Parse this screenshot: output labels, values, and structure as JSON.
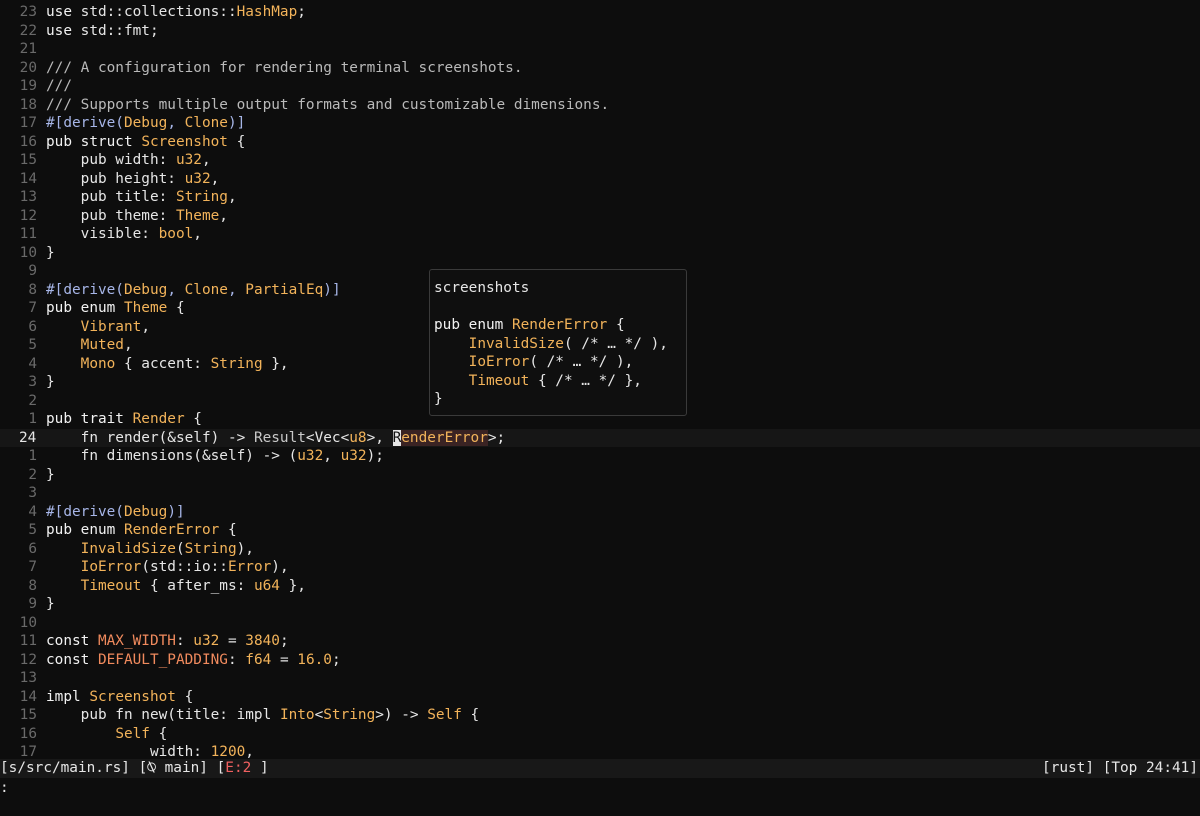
{
  "editor": {
    "current_line_label": "24",
    "lines": [
      {
        "num": "23",
        "tokens": [
          [
            "kw",
            "use "
          ],
          [
            "pl",
            "std::collections::"
          ],
          [
            "ty",
            "HashMap"
          ],
          [
            "pl",
            ";"
          ]
        ]
      },
      {
        "num": "22",
        "tokens": [
          [
            "kw",
            "use "
          ],
          [
            "pl",
            "std::fmt;"
          ]
        ]
      },
      {
        "num": "21",
        "tokens": []
      },
      {
        "num": "20",
        "tokens": [
          [
            "cm",
            "/// A configuration for rendering terminal screenshots."
          ]
        ]
      },
      {
        "num": "19",
        "tokens": [
          [
            "cm",
            "///"
          ]
        ]
      },
      {
        "num": "18",
        "tokens": [
          [
            "cm",
            "/// Supports multiple output formats and customizable dimensions."
          ]
        ]
      },
      {
        "num": "17",
        "tokens": [
          [
            "at",
            "#[derive("
          ],
          [
            "ty",
            "Debug"
          ],
          [
            "at",
            ", "
          ],
          [
            "ty",
            "Clone"
          ],
          [
            "at",
            ")]"
          ]
        ]
      },
      {
        "num": "16",
        "tokens": [
          [
            "kw",
            "pub struct "
          ],
          [
            "ty",
            "Screenshot"
          ],
          [
            "pl",
            " {"
          ]
        ]
      },
      {
        "num": "15",
        "tokens": [
          [
            "pl",
            "    pub width: "
          ],
          [
            "ty",
            "u32"
          ],
          [
            "pl",
            ","
          ]
        ]
      },
      {
        "num": "14",
        "tokens": [
          [
            "pl",
            "    pub height: "
          ],
          [
            "ty",
            "u32"
          ],
          [
            "pl",
            ","
          ]
        ]
      },
      {
        "num": "13",
        "tokens": [
          [
            "pl",
            "    pub title: "
          ],
          [
            "ty",
            "String"
          ],
          [
            "pl",
            ","
          ]
        ]
      },
      {
        "num": "12",
        "tokens": [
          [
            "pl",
            "    pub theme: "
          ],
          [
            "ty",
            "Theme"
          ],
          [
            "pl",
            ","
          ]
        ]
      },
      {
        "num": "11",
        "tokens": [
          [
            "pl",
            "    visible: "
          ],
          [
            "ty",
            "bool"
          ],
          [
            "pl",
            ","
          ]
        ]
      },
      {
        "num": "10",
        "tokens": [
          [
            "pl",
            "}"
          ]
        ]
      },
      {
        "num": "9",
        "tokens": []
      },
      {
        "num": "8",
        "tokens": [
          [
            "at",
            "#[derive("
          ],
          [
            "ty",
            "Debug"
          ],
          [
            "at",
            ", "
          ],
          [
            "ty",
            "Clone"
          ],
          [
            "at",
            ", "
          ],
          [
            "ty",
            "PartialEq"
          ],
          [
            "at",
            ")]"
          ]
        ]
      },
      {
        "num": "7",
        "tokens": [
          [
            "kw",
            "pub enum "
          ],
          [
            "ty",
            "Theme"
          ],
          [
            "pl",
            " {"
          ]
        ]
      },
      {
        "num": "6",
        "tokens": [
          [
            "pl",
            "    "
          ],
          [
            "vr",
            "Vibrant"
          ],
          [
            "pl",
            ","
          ]
        ]
      },
      {
        "num": "5",
        "tokens": [
          [
            "pl",
            "    "
          ],
          [
            "vr",
            "Muted"
          ],
          [
            "pl",
            ","
          ]
        ]
      },
      {
        "num": "4",
        "tokens": [
          [
            "pl",
            "    "
          ],
          [
            "vr",
            "Mono"
          ],
          [
            "pl",
            " { accent: "
          ],
          [
            "ty",
            "String"
          ],
          [
            "pl",
            " },"
          ]
        ]
      },
      {
        "num": "3",
        "tokens": [
          [
            "pl",
            "}"
          ]
        ]
      },
      {
        "num": "2",
        "tokens": []
      },
      {
        "num": "1",
        "tokens": [
          [
            "kw",
            "pub trait "
          ],
          [
            "ty",
            "Render"
          ],
          [
            "pl",
            " {"
          ]
        ]
      },
      {
        "num": "24",
        "current": true,
        "tokens": [
          [
            "pl",
            "    fn render(&self) -> "
          ],
          [
            "rs",
            "Result"
          ],
          [
            "pl",
            "<Vec<"
          ],
          [
            "ty",
            "u8"
          ],
          [
            "pl",
            ">, "
          ],
          [
            "cursor",
            "R"
          ],
          [
            "hl",
            "enderError"
          ],
          [
            "pl",
            ">;"
          ]
        ]
      },
      {
        "num": "1",
        "tokens": [
          [
            "pl",
            "    fn dimensions(&self) -> ("
          ],
          [
            "ty",
            "u32"
          ],
          [
            "pl",
            ", "
          ],
          [
            "ty",
            "u32"
          ],
          [
            "pl",
            ");"
          ]
        ]
      },
      {
        "num": "2",
        "tokens": [
          [
            "pl",
            "}"
          ]
        ]
      },
      {
        "num": "3",
        "tokens": []
      },
      {
        "num": "4",
        "tokens": [
          [
            "at",
            "#[derive("
          ],
          [
            "ty",
            "Debug"
          ],
          [
            "at",
            ")]"
          ]
        ]
      },
      {
        "num": "5",
        "tokens": [
          [
            "kw",
            "pub enum "
          ],
          [
            "ty",
            "RenderError"
          ],
          [
            "pl",
            " {"
          ]
        ]
      },
      {
        "num": "6",
        "tokens": [
          [
            "pl",
            "    "
          ],
          [
            "vr",
            "InvalidSize"
          ],
          [
            "pl",
            "("
          ],
          [
            "ty",
            "String"
          ],
          [
            "pl",
            "),"
          ]
        ]
      },
      {
        "num": "7",
        "tokens": [
          [
            "pl",
            "    "
          ],
          [
            "vr",
            "IoError"
          ],
          [
            "pl",
            "(std::io::"
          ],
          [
            "ty",
            "Error"
          ],
          [
            "pl",
            "),"
          ]
        ]
      },
      {
        "num": "8",
        "tokens": [
          [
            "pl",
            "    "
          ],
          [
            "vr",
            "Timeout"
          ],
          [
            "pl",
            " { after_ms: "
          ],
          [
            "ty",
            "u64"
          ],
          [
            "pl",
            " },"
          ]
        ]
      },
      {
        "num": "9",
        "tokens": [
          [
            "pl",
            "}"
          ]
        ]
      },
      {
        "num": "10",
        "tokens": []
      },
      {
        "num": "11",
        "tokens": [
          [
            "kw",
            "const "
          ],
          [
            "cst",
            "MAX_WIDTH"
          ],
          [
            "pl",
            ": "
          ],
          [
            "ty",
            "u32"
          ],
          [
            "pl",
            " = "
          ],
          [
            "nu",
            "3840"
          ],
          [
            "pl",
            ";"
          ]
        ]
      },
      {
        "num": "12",
        "tokens": [
          [
            "kw",
            "const "
          ],
          [
            "cst",
            "DEFAULT_PADDING"
          ],
          [
            "pl",
            ": "
          ],
          [
            "ty",
            "f64"
          ],
          [
            "pl",
            " = "
          ],
          [
            "nu",
            "16.0"
          ],
          [
            "pl",
            ";"
          ]
        ]
      },
      {
        "num": "13",
        "tokens": []
      },
      {
        "num": "14",
        "tokens": [
          [
            "kw",
            "impl "
          ],
          [
            "ty",
            "Screenshot"
          ],
          [
            "pl",
            " {"
          ]
        ]
      },
      {
        "num": "15",
        "tokens": [
          [
            "pl",
            "    pub fn new(title: impl "
          ],
          [
            "ty",
            "Into"
          ],
          [
            "pl",
            "<"
          ],
          [
            "ty",
            "String"
          ],
          [
            "pl",
            ">) -> "
          ],
          [
            "ty",
            "Self"
          ],
          [
            "pl",
            " {"
          ]
        ]
      },
      {
        "num": "16",
        "tokens": [
          [
            "pl",
            "        "
          ],
          [
            "ty",
            "Self"
          ],
          [
            "pl",
            " {"
          ]
        ]
      },
      {
        "num": "17",
        "tokens": [
          [
            "pl",
            "            width: "
          ],
          [
            "nu",
            "1200"
          ],
          [
            "pl",
            ","
          ]
        ]
      }
    ]
  },
  "hover_popup": {
    "lines": [
      [
        [
          "pl",
          "screenshots"
        ]
      ],
      [],
      [
        [
          "kw",
          "pub enum "
        ],
        [
          "ty",
          "RenderError"
        ],
        [
          "pl",
          " {"
        ]
      ],
      [
        [
          "pl",
          "    "
        ],
        [
          "vr",
          "InvalidSize"
        ],
        [
          "pl",
          "( /* … */ ),"
        ]
      ],
      [
        [
          "pl",
          "    "
        ],
        [
          "vr",
          "IoError"
        ],
        [
          "pl",
          "( /* … */ ),"
        ]
      ],
      [
        [
          "pl",
          "    "
        ],
        [
          "vr",
          "Timeout"
        ],
        [
          "pl",
          " { /* … */ },"
        ]
      ],
      [
        [
          "pl",
          "}"
        ]
      ]
    ]
  },
  "statusbar": {
    "file": "[s/src/main.rs]",
    "branch": "[⍉ main]",
    "errors_open": "[",
    "errors": "E:2",
    "errors_close": " ]",
    "filetype": "[rust]",
    "position": "[Top 24:41]"
  },
  "cmdline": {
    "text": ":"
  },
  "colors": {
    "background": "#0d0d0d",
    "type": "#f2b35a",
    "attribute": "#a7b6e8",
    "constant": "#f08a5d",
    "error": "#f06060"
  }
}
